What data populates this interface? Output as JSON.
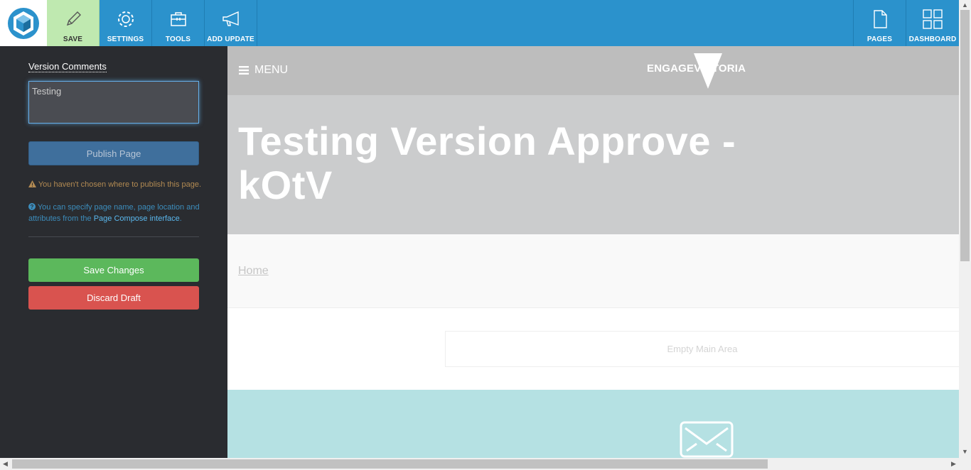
{
  "toolbar": {
    "save_label": "SAVE",
    "settings_label": "SETTINGS",
    "tools_label": "TOOLS",
    "add_update_label": "ADD UPDATE",
    "pages_label": "PAGES",
    "dashboard_label": "DASHBOARD"
  },
  "panel": {
    "version_comments_label": "Version Comments",
    "version_comments_value": "Testing",
    "publish_button": "Publish Page",
    "warning_text": "You haven't chosen where to publish this page.",
    "info_text_before": "You can specify page name, page location and attributes from the",
    "info_link": "Page Compose interface",
    "info_text_after": ".",
    "save_changes_button": "Save Changes",
    "discard_draft_button": "Discard Draft"
  },
  "preview": {
    "menu_label": "MENU",
    "brand_text": "ENGAGEVICTORIA",
    "hero_title": "Testing Version Approve - kOtV",
    "breadcrumb_home": "Home",
    "empty_main_area": "Empty Main Area"
  },
  "icons": {
    "save": "pencil-icon",
    "settings": "gear-icon",
    "tools": "toolbox-icon",
    "add_update": "megaphone-icon",
    "pages": "page-icon",
    "dashboard": "grid-icon",
    "warning": "warning-icon",
    "info": "question-circle-icon",
    "menu": "hamburger-icon",
    "mail": "envelope-icon"
  },
  "colors": {
    "toolbar": "#2b92cc",
    "save_active": "#bfe9b0",
    "panel_bg": "#2a2c30",
    "publish_btn": "#3f6f9c",
    "save_btn": "#5cb85c",
    "discard_btn": "#d9534f",
    "mail_band": "#b5e1e3"
  }
}
